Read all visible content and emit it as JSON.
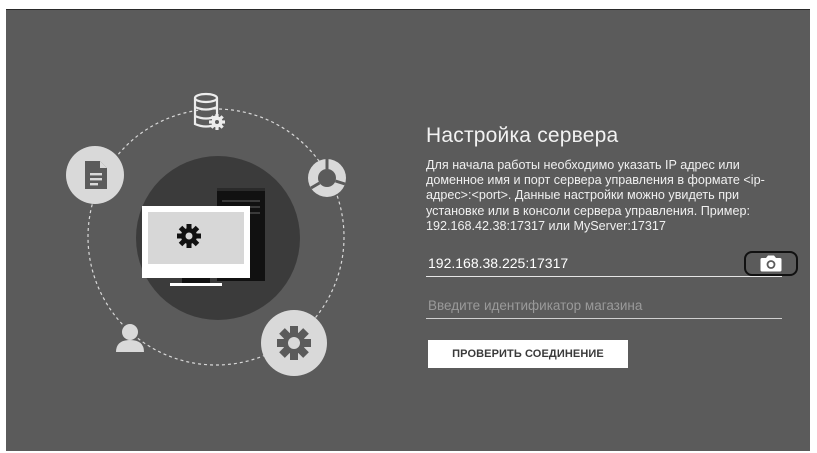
{
  "title": "Настройка сервера",
  "description": "Для начала работы необходимо указать IP адрес или доменное имя и порт сервера управления в формате <ip-адрес>:<port>. Данные настройки можно увидеть при установке или в консоли сервера управления. Пример: 192.168.42.38:17317 или MyServer:17317",
  "server_address": {
    "value": "192.168.38.225:17317"
  },
  "store_id": {
    "placeholder": "Введите идентификатор магазина"
  },
  "check_button_label": "ПРОВЕРИТЬ СОЕДИНЕНИЕ",
  "icons": {
    "scan": "camera-icon",
    "database": "database-gear-icon",
    "document": "document-icon",
    "chart": "pie-chart-icon",
    "user": "user-icon",
    "settings": "gear-icon",
    "computer": "computer-icon"
  },
  "colors": {
    "background": "#5b5b5b",
    "button": "#ffffff",
    "circle": "#d9d9d9",
    "center_disc": "#3c3c3c"
  }
}
